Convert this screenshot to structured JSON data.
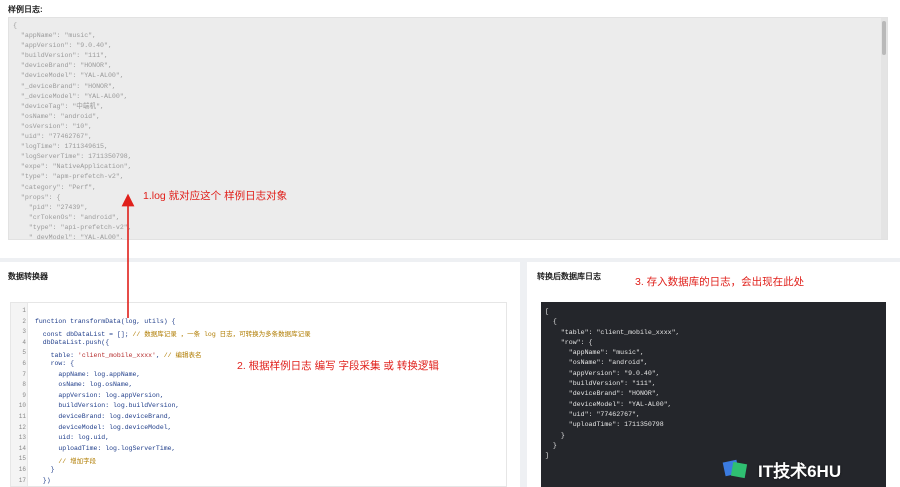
{
  "sample": {
    "title": "样例日志:",
    "lines": [
      "{",
      "  \"appName\": \"music\",",
      "  \"appVersion\": \"9.0.40\",",
      "  \"buildVersion\": \"111\",",
      "  \"deviceBrand\": \"HONOR\",",
      "  \"deviceModel\": \"YAL-AL00\",",
      "  \"_deviceBrand\": \"HONOR\",",
      "  \"_deviceModel\": \"YAL-AL00\",",
      "  \"deviceTag\": \"中端机\",",
      "  \"osName\": \"android\",",
      "  \"osVersion\": \"10\",",
      "  \"uid\": \"77462767\",",
      "  \"logTime\": 1711349615,",
      "  \"logServerTime\": 1711350798,",
      "  \"expe\": \"NativeApplication\",",
      "  \"type\": \"apm-prefetch-v2\",",
      "  \"category\": \"Perf\",",
      "  \"props\": {",
      "    \"pid\": \"27439\",",
      "    \"crTokenOs\": \"android\",",
      "    \"type\": \"api-prefetch-v2\",",
      "    \"_devModel\": \"YAL-AL00\","
    ]
  },
  "converter": {
    "title": "数据转换器",
    "line_numbers": [
      "1",
      "2",
      "3",
      "4",
      "5",
      "6",
      "7",
      "8",
      "9",
      "10",
      "11",
      "12",
      "13",
      "14",
      "15",
      "16",
      "17"
    ],
    "code": [
      {
        "code": ""
      },
      {
        "code": "function transformData(log, utils) {"
      },
      {
        "code": "  const dbDataList = []; ",
        "comment": "// 数据库记录 ，一条 log 日志，可转换为多条数据库记录"
      },
      {
        "code": "  dbDataList.push({"
      },
      {
        "code": "    table: ",
        "str": "'client_mobile_xxxx'",
        "tail": ", ",
        "comment": "// 编辑表名"
      },
      {
        "code": "    row: {"
      },
      {
        "code": "      appName: log.appName,"
      },
      {
        "code": "      osName: log.osName,"
      },
      {
        "code": "      appVersion: log.appVersion,"
      },
      {
        "code": "      buildVersion: log.buildVersion,"
      },
      {
        "code": "      deviceBrand: log.deviceBrand,"
      },
      {
        "code": "      deviceModel: log.deviceModel,"
      },
      {
        "code": "      uid: log.uid,"
      },
      {
        "code": "      uploadTime: log.logServerTime,"
      },
      {
        "code": "      ",
        "comment": "// 增加字段"
      },
      {
        "code": "    }"
      },
      {
        "code": "  })"
      }
    ]
  },
  "output": {
    "title": "转换后数据库日志",
    "lines": [
      "[",
      "  {",
      "    \"table\": \"client_mobile_xxxx\",",
      "    \"row\": {",
      "      \"appName\": \"music\",",
      "      \"osName\": \"android\",",
      "      \"appVersion\": \"9.0.40\",",
      "      \"buildVersion\": \"111\",",
      "      \"deviceBrand\": \"HONOR\",",
      "      \"deviceModel\": \"YAL-AL00\",",
      "      \"uid\": \"77462767\",",
      "      \"uploadTime\": 1711350798",
      "    }",
      "  }",
      "]"
    ]
  },
  "annotations": {
    "a1": "1.log 就对应这个 样例日志对象",
    "a2": "2. 根据样例日志 编写 字段采集 或 转换逻辑",
    "a3": "3. 存入数据库的日志，会出现在此处"
  },
  "watermark": {
    "text": "IT技术6HU"
  },
  "colors": {
    "annotation": "#e0201b",
    "dark_bg": "#24262b",
    "sample_bg": "#ececec"
  }
}
